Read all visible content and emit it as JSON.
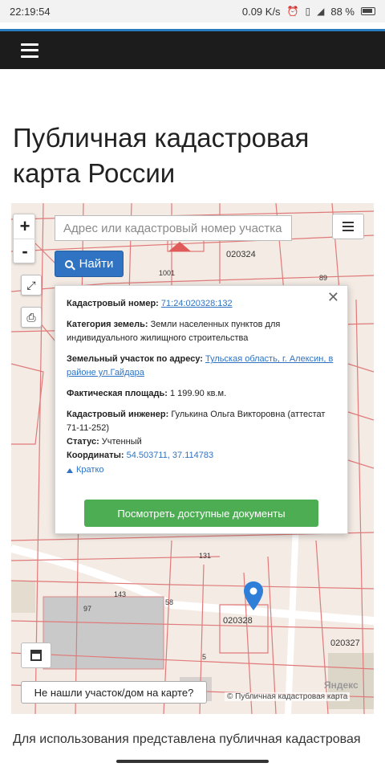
{
  "status_bar": {
    "time": "22:19:54",
    "speed": "0.09 K/s",
    "battery": "88 %"
  },
  "page": {
    "title": "Публичная кадастровая карта России",
    "intro_text": "Для использования представлена публичная кадастровая"
  },
  "map": {
    "zoom_in_label": "+",
    "zoom_out_label": "-",
    "search_placeholder": "Адрес или кадастровый номер участка",
    "find_label": "Найти",
    "parcel_labels": [
      "020324",
      "020328",
      "020327",
      "1001",
      "89",
      "131",
      "58",
      "143",
      "97",
      "5"
    ],
    "not_found_label": "Не нашли участок/дом на карте?",
    "attribution": "© Публичная кадастровая карта",
    "yandex": "Яндекс"
  },
  "popup": {
    "cadastral_number_label": "Кадастровый номер:",
    "cadastral_number_value": "71:24:020328:132",
    "land_category_label": "Категория земель:",
    "land_category_value": "Земли населенных пунктов для индивидуального жилищного строительства",
    "address_label": "Земельный участок по адресу:",
    "address_value": "Тульская область, г. Алексин, в районе ул.Гайдара",
    "area_label": "Фактическая площадь:",
    "area_value": "1 199.90 кв.м.",
    "engineer_label": "Кадастровый инженер:",
    "engineer_value": "Гулькина Ольга Викторовна (аттестат 71-11-252)",
    "status_label": "Статус:",
    "status_value": "Учтенный",
    "coords_label": "Координаты:",
    "coords_value": "54.503711, 37.114783",
    "short_label": "Кратко",
    "docs_button": "Посмотреть доступные документы"
  },
  "colors": {
    "appbar": "#1c1c1c",
    "find_button": "#2f73c2",
    "docs_button": "#4cad52",
    "pin": "#2f7fd9",
    "parcel_lines": "#e07a7a"
  }
}
